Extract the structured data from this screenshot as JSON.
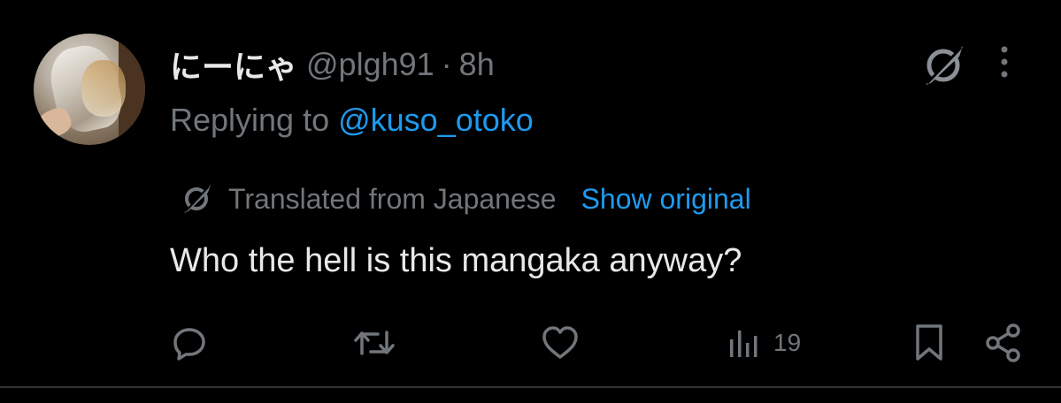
{
  "post": {
    "author": {
      "display_name": "にーにゃ",
      "handle": "@plgh91",
      "separator": "·",
      "time": "8h"
    },
    "replying_prefix": "Replying to ",
    "replying_to": "@kuso_otoko",
    "translation": {
      "label": "Translated from Japanese",
      "show_original": "Show original"
    },
    "text": "Who the hell is this mangaka anyway?",
    "actions": {
      "views_count": "19"
    }
  },
  "colors": {
    "background": "#000000",
    "text_primary": "#e7e9ea",
    "text_secondary": "#71767b",
    "accent": "#1d9bf0"
  },
  "icons": [
    "grok-icon",
    "more-options-icon",
    "reply-icon",
    "repost-icon",
    "like-icon",
    "views-icon",
    "bookmark-icon",
    "share-icon"
  ]
}
